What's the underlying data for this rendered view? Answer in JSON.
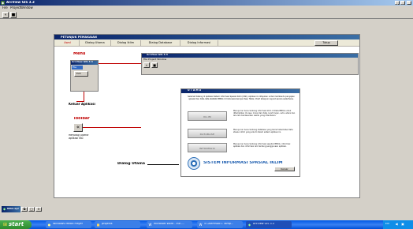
{
  "window": {
    "title": "ArcView GIS 3.3"
  },
  "menubar": {
    "items": [
      "File",
      "Project",
      "Window"
    ]
  },
  "petunjuk": {
    "title": "PETUNJUK PEMAKAIAN",
    "tabs": [
      "Awal",
      "Dialog Utama",
      "Dialog Iklim",
      "Dialog Database",
      "Dialog Informasi"
    ],
    "close_label": "Tutup"
  },
  "annotations": {
    "menu": "Menu",
    "keluar": "Keluar Aplikasi",
    "toolbar": "Toolbar",
    "toolbar_desc": "Menutup utama aplikasi SIG",
    "dialog_utama": "Dialog Utama"
  },
  "mini_window": {
    "title": "ArcView GIS 3.3",
    "submenu_item": "Exit",
    "selected_item": "File",
    "menu": "File  Project  Window"
  },
  "mini_window2": {
    "title": "ArcView GIS 3.3",
    "menu": "File  Project  Window"
  },
  "utama": {
    "title": "U T A M A",
    "intro": "Selamat datang di Aplikasi Sistem Informasi Spasial Iklim (SISI). Aplikasi ini ditujukan untuk membantu penyajian spasial dan data-data statistik BMKG di Indonesia berupa View, Table, Chart ataupun Layout secara sederhana.",
    "buttons": [
      {
        "label": "IKLIM",
        "desc": "Menuju ke menu tentang informasi iklim di Data BMKG untuk ditampilkan di view, mulai dari data curah hujan, suhu udara dan lain-lain berdasarkan waktu yang ditentukan."
      },
      {
        "label": "DATABASE",
        "desc": "Menuju ke menu tentang database yang berisi tabel-tabel data stasiun iklim yang ada di dalam sistem aplikasi ini."
      },
      {
        "label": "INFORMASI",
        "desc": "Menuju ke menu tentang informasi seputar BMKG, informasi aplikasi dan informasi lain tentang penggunaan aplikasi."
      }
    ],
    "footer_title": "SISTEM INFORMASI SPASIAL IKLIM",
    "close_label": "Keluar"
  },
  "minimized": {
    "title": "Iklim.apr"
  },
  "taskbar": {
    "start": "start",
    "items": [
      "Windows Media Player",
      "projects",
      "Microsoft Word - ind -...",
      "5 LAMPIRAN 1 Tamp...",
      "ArcView GIS 3.3"
    ],
    "tray": "EN"
  },
  "colors": {
    "title_blue": "#0a246a",
    "xp_blue": "#245edb",
    "start_green": "#3c9a3c",
    "annotation_red": "#c00000",
    "face": "#d4d0c8"
  }
}
